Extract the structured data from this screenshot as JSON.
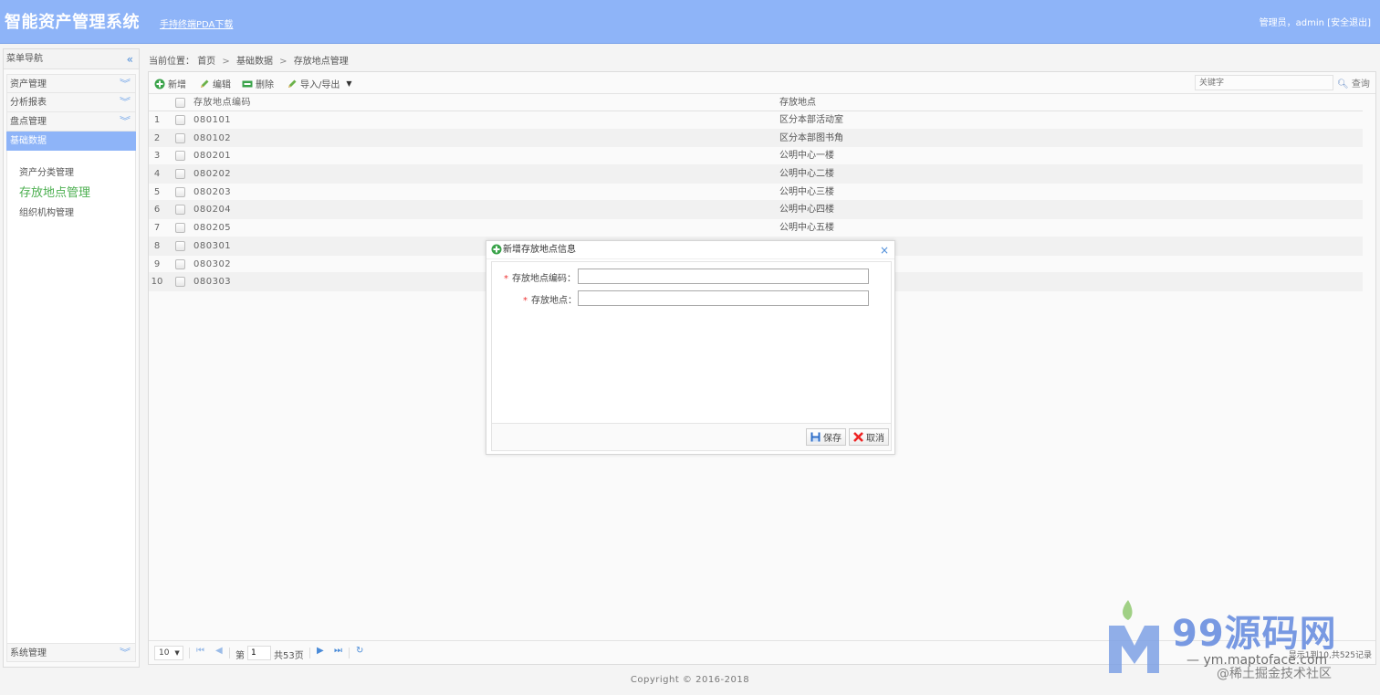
{
  "header": {
    "title": "智能资产管理系统",
    "pda_link": "手持终端PDA下载",
    "user_text": "管理员，admin",
    "logout": "[安全退出]"
  },
  "sidebar": {
    "title": "菜单导航",
    "menus": [
      {
        "label": "资产管理"
      },
      {
        "label": "分析报表"
      },
      {
        "label": "盘点管理"
      },
      {
        "label": "基础数据"
      }
    ],
    "submenu": [
      {
        "label": "资产分类管理"
      },
      {
        "label": "存放地点管理"
      },
      {
        "label": "组织机构管理"
      }
    ],
    "bottom_menu": "系统管理"
  },
  "breadcrumb": {
    "prefix": "当前位置：",
    "items": [
      "首页",
      "基础数据",
      "存放地点管理"
    ]
  },
  "toolbar": {
    "add": "新增",
    "edit": "编辑",
    "delete": "删除",
    "import_export": "导入/导出",
    "search_placeholder": "关键字",
    "search": "查询"
  },
  "table": {
    "columns": [
      "存放地点编码",
      "存放地点"
    ],
    "rows": [
      {
        "num": "1",
        "code": "080101",
        "location": "区分本部活动室"
      },
      {
        "num": "2",
        "code": "080102",
        "location": "区分本部图书角"
      },
      {
        "num": "3",
        "code": "080201",
        "location": "公明中心一楼"
      },
      {
        "num": "4",
        "code": "080202",
        "location": "公明中心二楼"
      },
      {
        "num": "5",
        "code": "080203",
        "location": "公明中心三楼"
      },
      {
        "num": "6",
        "code": "080204",
        "location": "公明中心四楼"
      },
      {
        "num": "7",
        "code": "080205",
        "location": "公明中心五楼"
      },
      {
        "num": "8",
        "code": "080301",
        "location": ""
      },
      {
        "num": "9",
        "code": "080302",
        "location": ""
      },
      {
        "num": "10",
        "code": "080303",
        "location": ""
      }
    ]
  },
  "pager": {
    "page_size": "10",
    "page_prefix": "第",
    "page_value": "1",
    "page_total": "共53页",
    "info": "显示1到10,共525记录"
  },
  "dialog": {
    "title": "新增存放地点信息",
    "fields": [
      {
        "label": "存放地点编码：",
        "value": ""
      },
      {
        "label": "存放地点：",
        "value": ""
      }
    ],
    "required_mark": "*",
    "save": "保存",
    "cancel": "取消"
  },
  "footer": {
    "copyright": "Copyright © 2016-2018"
  },
  "watermark": {
    "brand": "99源码网",
    "url": "— ym.maptoface.com",
    "note": "@稀土掘金技术社区"
  },
  "colors": {
    "header_bg": "#8eb4f8",
    "accent_blue": "#4a8bd8",
    "active_green": "#4caf50",
    "required_red": "#e33333"
  }
}
